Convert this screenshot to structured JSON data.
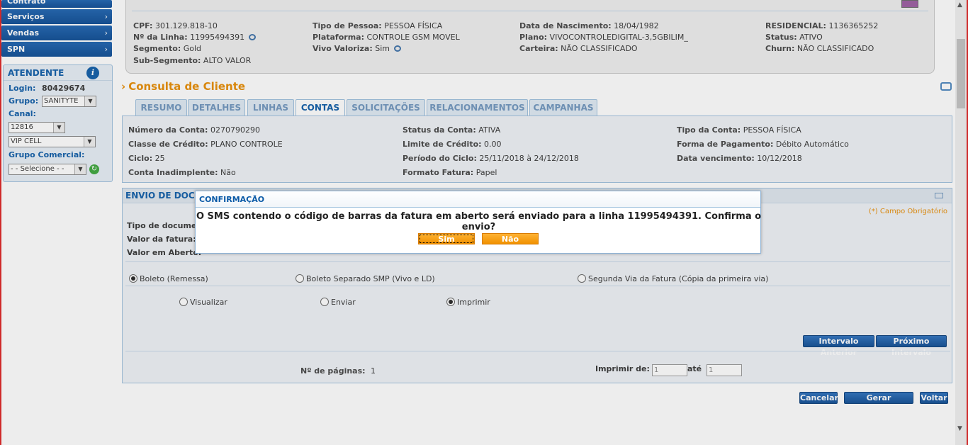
{
  "sidebar": {
    "nav": [
      {
        "label": "Contrato"
      },
      {
        "label": "Serviços"
      },
      {
        "label": "Vendas"
      },
      {
        "label": "SPN"
      }
    ],
    "atendente": {
      "title": "ATENDENTE",
      "login_label": "Login:",
      "login_value": "80429674",
      "grupo_label": "Grupo:",
      "grupo_value": "SANITYTE",
      "canal_label": "Canal:",
      "canal_value": "12816",
      "canal2_value": "VIP CELL",
      "grupo_comercial_label": "Grupo Comercial:",
      "grupo_comercial_value": "- - Selecione - -"
    }
  },
  "customer": {
    "cpf_label": "CPF:",
    "cpf": "301.129.818-10",
    "linha_label": "Nº da Linha:",
    "linha": "11995494391",
    "segmento_label": "Segmento:",
    "segmento": "Gold",
    "subsegmento_label": "Sub-Segmento:",
    "subsegmento": "ALTO VALOR",
    "tipo_pessoa_label": "Tipo de Pessoa:",
    "tipo_pessoa": "PESSOA FÍSICA",
    "plataforma_label": "Plataforma:",
    "plataforma": "CONTROLE GSM MOVEL",
    "valoriza_label": "Vivo Valoriza:",
    "valoriza": "Sim",
    "nascimento_label": "Data de Nascimento:",
    "nascimento": "18/04/1982",
    "plano_label": "Plano:",
    "plano": "VIVOCONTROLEDIGITAL-3,5GBILIM_",
    "carteira_label": "Carteira:",
    "carteira": "NÃO CLASSIFICADO",
    "residencial_label": "RESIDENCIAL:",
    "residencial": "1136365252",
    "status_label": "Status:",
    "status": "ATIVO",
    "churn_label": "Churn:",
    "churn": "NÃO CLASSIFICADO"
  },
  "section_title": "Consulta de Cliente",
  "tabs": [
    {
      "label": "RESUMO"
    },
    {
      "label": "DETALHES"
    },
    {
      "label": "LINHAS"
    },
    {
      "label": "CONTAS"
    },
    {
      "label": "SOLICITAÇÕES"
    },
    {
      "label": "RELACIONAMENTOS"
    },
    {
      "label": "CAMPANHAS"
    }
  ],
  "account": {
    "numero_label": "Número da Conta:",
    "numero": "0270790290",
    "classe_label": "Classe de Crédito:",
    "classe": "PLANO CONTROLE",
    "ciclo_label": "Ciclo:",
    "ciclo": "25",
    "inadimplente_label": "Conta Inadimplente:",
    "inadimplente": "Não",
    "status_label": "Status da Conta:",
    "status": "ATIVA",
    "limite_label": "Limite de Crédito:",
    "limite": "0.00",
    "periodo_label": "Período do Ciclo:",
    "periodo": "25/11/2018 à 24/12/2018",
    "formato_label": "Formato Fatura:",
    "formato": "Papel",
    "tipo_label": "Tipo da Conta:",
    "tipo": "PESSOA FÍSICA",
    "pagamento_label": "Forma de Pagamento:",
    "pagamento": "Débito Automático",
    "vencimento_label": "Data vencimento:",
    "vencimento": "10/12/2018"
  },
  "envio": {
    "title": "ENVIO DE DOCU",
    "required": "(*) Campo Obrigatório",
    "tipo_doc_label": "Tipo de documen",
    "valor_fatura_label": "Valor da fatura:",
    "valor_aberto_label": "Valor em Aberto:",
    "doc_options": [
      {
        "label": "Boleto (Remessa)",
        "checked": true
      },
      {
        "label": "Boleto Separado SMP (Vivo e LD)",
        "checked": false
      },
      {
        "label": "Segunda Via da Fatura (Cópia da primeira via)",
        "checked": false
      }
    ],
    "action_options": [
      {
        "label": "Visualizar",
        "checked": false
      },
      {
        "label": "Enviar",
        "checked": false
      },
      {
        "label": "Imprimir",
        "checked": true
      }
    ],
    "prev_interval": "Intervalo Anterior",
    "next_interval": "Próximo Intervalo",
    "paginas_label": "Nº de páginas:",
    "paginas": "1",
    "imprimir_de_label": "Imprimir de:",
    "imprimir_de": "1",
    "ate_label": "até",
    "ate": "1"
  },
  "footer_buttons": {
    "cancelar": "Cancelar",
    "gerar": "Gerar Solicitação",
    "voltar": "Voltar"
  },
  "modal": {
    "title": "CONFIRMAÇÃO",
    "message": "O SMS contendo o código de barras da fatura em aberto será enviado para a linha 11995494391. Confirma o envio?",
    "yes": "Sim",
    "no": "Não"
  }
}
